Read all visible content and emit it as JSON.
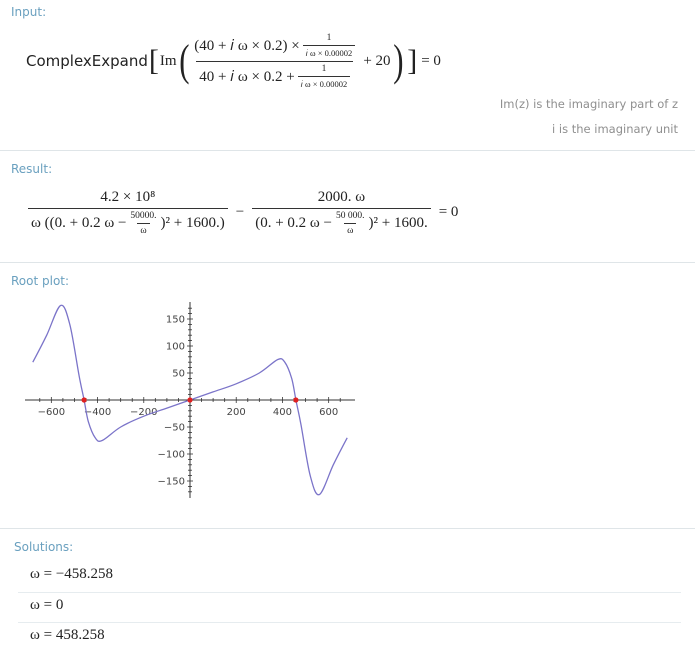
{
  "input": {
    "title": "Input:",
    "func": "ComplexExpand",
    "im": "Im",
    "outer_num": "(40 + 𝑖 ω × 0.2) ×",
    "inner_num_top": "1",
    "inner_num_bot": "𝑖 ω × 0.00002",
    "outer_den": "40 + 𝑖 ω × 0.2 +",
    "inner_den_top": "1",
    "inner_den_bot": "𝑖 ω × 0.00002",
    "plus20": "+ 20",
    "eq": "= 0",
    "note1": "Im(z) is the imaginary part of z",
    "note2": "i is the imaginary unit"
  },
  "result": {
    "title": "Result:",
    "t1_num": "4.2 × 10⁸",
    "t1_den_a": "ω ((0. + 0.2 ω −",
    "t1_den_frac_top": "50000.",
    "t1_den_frac_bot": "ω",
    "t1_den_b": ")² + 1600.)",
    "minus": "−",
    "t2_num": "2000. ω",
    "t2_den_a": "(0. + 0.2 ω −",
    "t2_den_frac_top": "50 000.",
    "t2_den_frac_bot": "ω",
    "t2_den_b": ")² + 1600.",
    "eq": "= 0"
  },
  "root_plot": {
    "title": "Root plot:",
    "x_ticks": [
      "−600",
      "−400",
      "−200",
      "200",
      "400",
      "600"
    ],
    "y_ticks": [
      "150",
      "100",
      "50",
      "−50",
      "−100",
      "−150"
    ]
  },
  "chart_data": {
    "type": "line",
    "x_range": [
      -680,
      680
    ],
    "y_range": [
      -185,
      185
    ],
    "series": [
      {
        "color": "#7b74c9",
        "x": [
          -680,
          -620,
          -560,
          -520,
          -480,
          -458.258,
          -440,
          -410,
          -380,
          -300,
          -200,
          -100,
          0,
          100,
          200,
          300,
          380,
          410,
          440,
          458.258,
          480,
          520,
          560,
          620,
          680
        ],
        "y": [
          70,
          120,
          175,
          140,
          45,
          0,
          -40,
          -70,
          -75,
          -50,
          -30,
          -15,
          0,
          15,
          30,
          50,
          75,
          70,
          40,
          0,
          -45,
          -140,
          -175,
          -120,
          -70
        ]
      }
    ],
    "roots": [
      -458.258,
      0,
      458.258
    ],
    "root_color": "#e02020"
  },
  "solutions": {
    "title": "Solutions:",
    "items": [
      "ω = −458.258",
      "ω = 0",
      "ω = 458.258"
    ]
  },
  "colors": {
    "pod_title": "#6aa0bf",
    "divider": "#dfe5e8",
    "curve": "#7b74c9",
    "root": "#e02020"
  }
}
